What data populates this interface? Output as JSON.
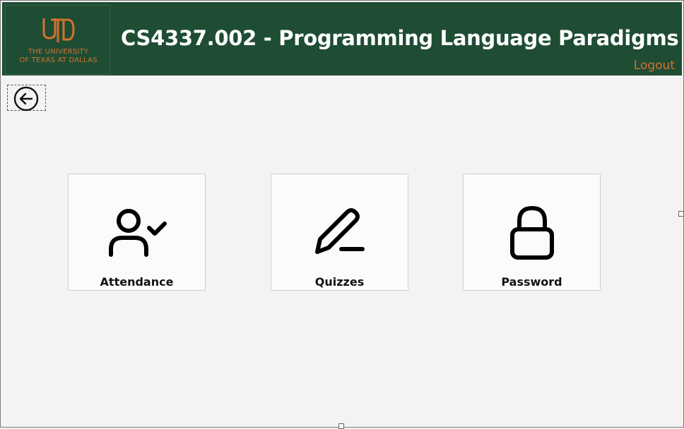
{
  "header": {
    "logo": {
      "monogram": "UTD",
      "line1": "THE UNIVERSITY",
      "line2": "OF TEXAS AT DALLAS"
    },
    "title": "CS4337.002 - Programming Language Paradigms",
    "logout_label": "Logout"
  },
  "nav": {
    "back_icon": "arrow-left-circle-icon"
  },
  "tiles": [
    {
      "label": "Attendance",
      "icon": "user-check-icon"
    },
    {
      "label": "Quizzes",
      "icon": "pencil-icon"
    },
    {
      "label": "Password",
      "icon": "lock-icon"
    }
  ],
  "colors": {
    "header_bg": "#1e4d34",
    "accent_orange": "#d5712d",
    "page_bg": "#f3f3f3"
  }
}
